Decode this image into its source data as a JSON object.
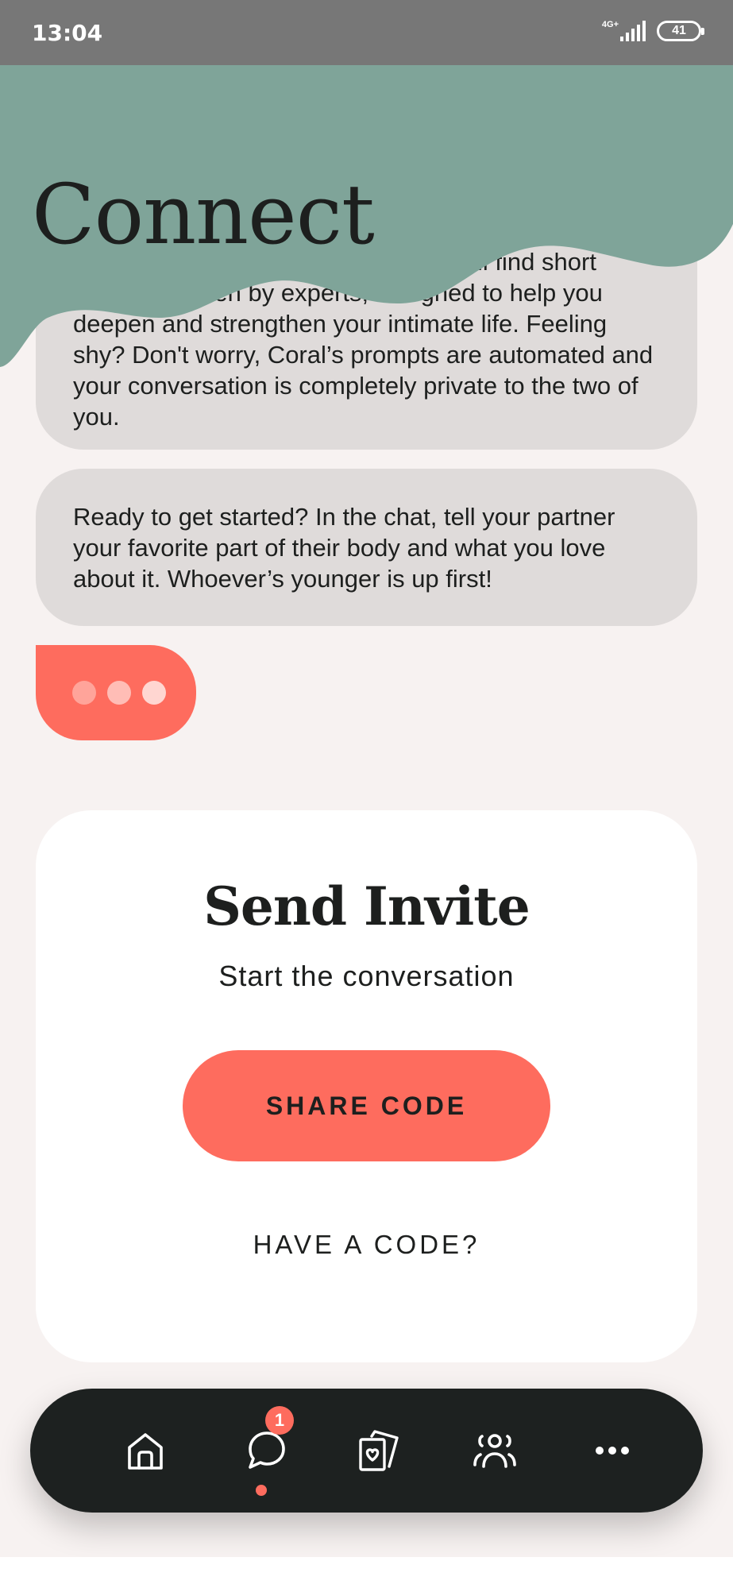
{
  "status_bar": {
    "time": "13:04",
    "network": "4G+",
    "battery": "41"
  },
  "header": {
    "title": "Connect",
    "background_color": "#7fa499"
  },
  "messages": [
    {
      "id": "intro",
      "text": "This is your conversation, where you'll find short prompts written by experts, designed to help you deepen and strengthen your intimate life. Feeling shy? Don't worry, Coral’s prompts are automated and your conversation is completely private to the two of you."
    },
    {
      "id": "prompt",
      "text": "Ready to get started? In the chat, tell your partner your favorite part of their body and what you love about it. Whoever’s younger is up first!"
    }
  ],
  "typing_indicator": {
    "state": "typing"
  },
  "invite": {
    "title": "Send Invite",
    "subtitle": "Start the conversation",
    "share_button": "SHARE CODE",
    "have_code_link": "HAVE A CODE?"
  },
  "bottom_nav": {
    "items": [
      {
        "name": "home",
        "icon": "home-icon",
        "active": false
      },
      {
        "name": "chat",
        "icon": "chat-bubble-icon",
        "active": true
      },
      {
        "name": "cards",
        "icon": "cards-heart-icon",
        "active": false
      },
      {
        "name": "partner",
        "icon": "people-icon",
        "active": false
      },
      {
        "name": "more",
        "icon": "more-dots-icon",
        "active": false
      }
    ],
    "chat_badge": "1"
  },
  "colors": {
    "accent": "#fe6c5e",
    "header_green": "#7fa499",
    "background": "#f7f2f1",
    "bubble": "#dfdbda",
    "dark": "#1d2120"
  }
}
